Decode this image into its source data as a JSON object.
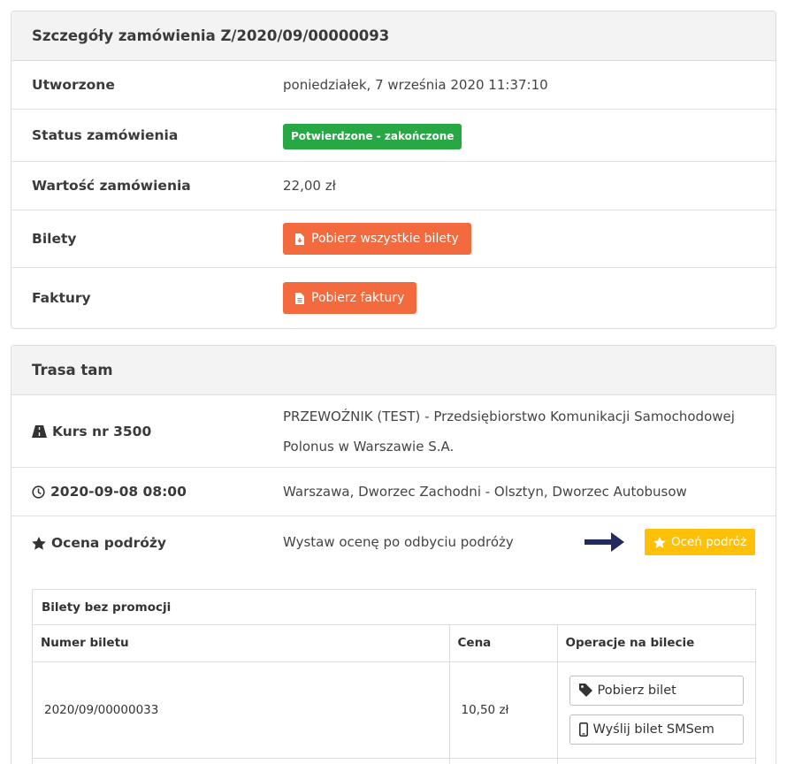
{
  "order": {
    "title": "Szczegóły zamówienia Z/2020/09/00000093",
    "created_label": "Utworzone",
    "created_value": "poniedziałek, 7 września 2020 11:37:10",
    "status_label": "Status zamówienia",
    "status_value": "Potwierdzone - zakończone",
    "value_label": "Wartość zamówienia",
    "value_value": "22,00 zł",
    "tickets_label": "Bilety",
    "tickets_button": "Pobierz wszystkie bilety",
    "invoices_label": "Faktury",
    "invoices_button": "Pobierz faktury"
  },
  "route": {
    "title": "Trasa tam",
    "course_label": "Kurs nr 3500",
    "course_value_line1": "PRZEWOŹNIK (TEST) - Przedsiębiorstwo Komunikacji Samochodowej",
    "course_value_line2": "Polonus w Warszawie S.A.",
    "datetime_label": "2020-09-08 08:00",
    "datetime_value": "Warszawa, Dworzec Zachodni - Olsztyn, Dworzec Autobusow",
    "rating_label": "Ocena podróży",
    "rating_value": "Wystaw ocenę po odbyciu podróży",
    "rating_button": "Oceń podróż"
  },
  "tickets_table": {
    "caption": "Bilety bez promocji",
    "headers": [
      "Numer biletu",
      "Cena",
      "Operacje na bilecie"
    ],
    "rows": [
      {
        "number": "2020/09/00000033",
        "price": "10,50 zł",
        "download": "Pobierz bilet",
        "sms": "Wyślij bilet SMSem"
      }
    ]
  },
  "colors": {
    "success": "#28a745",
    "primary_orange": "#f26a3d",
    "warning_yellow": "#ffc107",
    "arrow_navy": "#232a5c"
  }
}
